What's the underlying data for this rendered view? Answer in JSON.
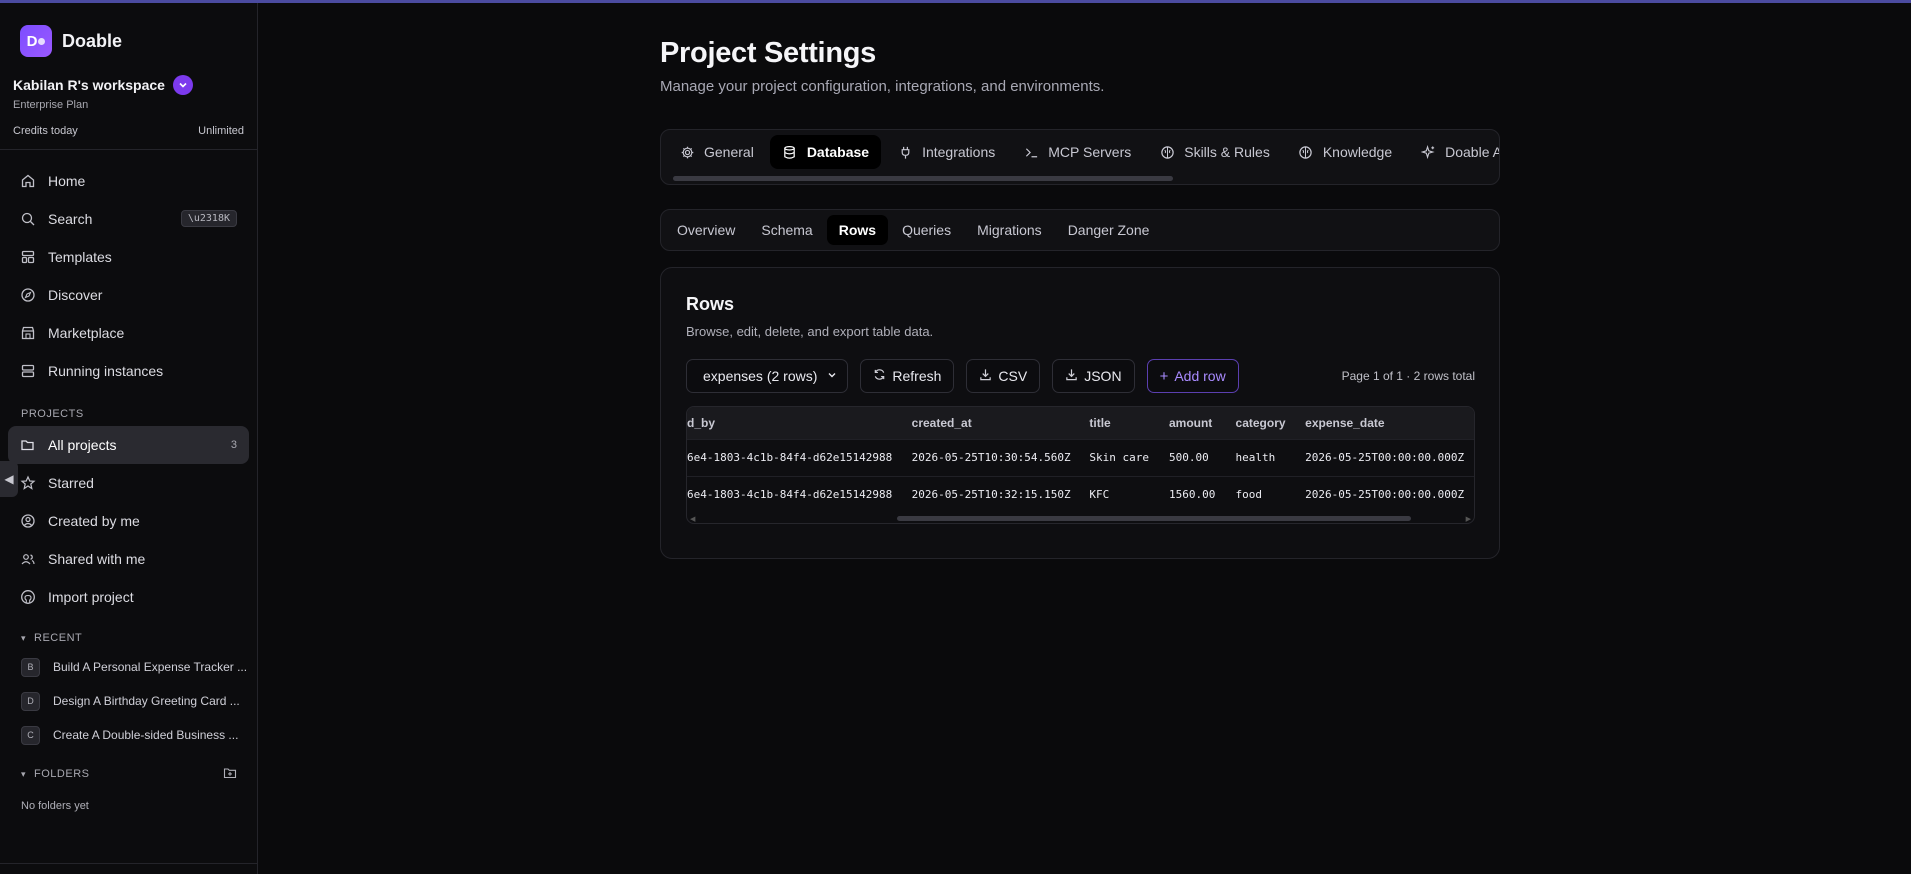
{
  "brand": {
    "name": "Doable",
    "logo_letter": "D"
  },
  "workspace": {
    "name": "Kabilan R's workspace",
    "plan": "Enterprise Plan",
    "credits_label": "Credits today",
    "credits_value": "Unlimited"
  },
  "nav": {
    "home": "Home",
    "search": "Search",
    "search_shortcut": "\\u2318K",
    "templates": "Templates",
    "discover": "Discover",
    "marketplace": "Marketplace",
    "running": "Running instances"
  },
  "projects": {
    "label": "PROJECTS",
    "all": "All projects",
    "all_count": "3",
    "starred": "Starred",
    "created_by_me": "Created by me",
    "shared": "Shared with me",
    "import": "Import project"
  },
  "recent": {
    "label": "RECENT",
    "items": [
      {
        "badge": "B",
        "title": "Build A Personal Expense Tracker ..."
      },
      {
        "badge": "D",
        "title": "Design A Birthday Greeting Card ..."
      },
      {
        "badge": "C",
        "title": "Create A Double-sided Business ..."
      }
    ]
  },
  "folders": {
    "label": "FOLDERS",
    "empty": "No folders yet"
  },
  "page": {
    "title": "Project Settings",
    "subtitle": "Manage your project configuration, integrations, and environments."
  },
  "tabs": [
    "General",
    "Database",
    "Integrations",
    "MCP Servers",
    "Skills & Rules",
    "Knowledge",
    "Doable AI"
  ],
  "active_tab": "Database",
  "subtabs": [
    "Overview",
    "Schema",
    "Rows",
    "Queries",
    "Migrations",
    "Danger Zone"
  ],
  "active_subtab": "Rows",
  "rows_card": {
    "title": "Rows",
    "subtitle": "Browse, edit, delete, and export table data.",
    "table_select": "expenses (2 rows)",
    "refresh": "Refresh",
    "csv": "CSV",
    "json": "JSON",
    "add_row": "Add row",
    "page_info": "Page 1 of 1 · 2 rows total"
  },
  "table": {
    "columns": [
      "d_by",
      "created_at",
      "title",
      "amount",
      "category",
      "expense_date"
    ],
    "rows": [
      [
        "6e4-1803-4c1b-84f4-d62e15142988",
        "2026-05-25T10:30:54.560Z",
        "Skin care",
        "500.00",
        "health",
        "2026-05-25T00:00:00.000Z"
      ],
      [
        "6e4-1803-4c1b-84f4-d62e15142988",
        "2026-05-25T10:32:15.150Z",
        "KFC",
        "1560.00",
        "food",
        "2026-05-25T00:00:00.000Z"
      ]
    ]
  },
  "colors": {
    "accent": "#7c3aed",
    "background": "#0a0a0c"
  }
}
